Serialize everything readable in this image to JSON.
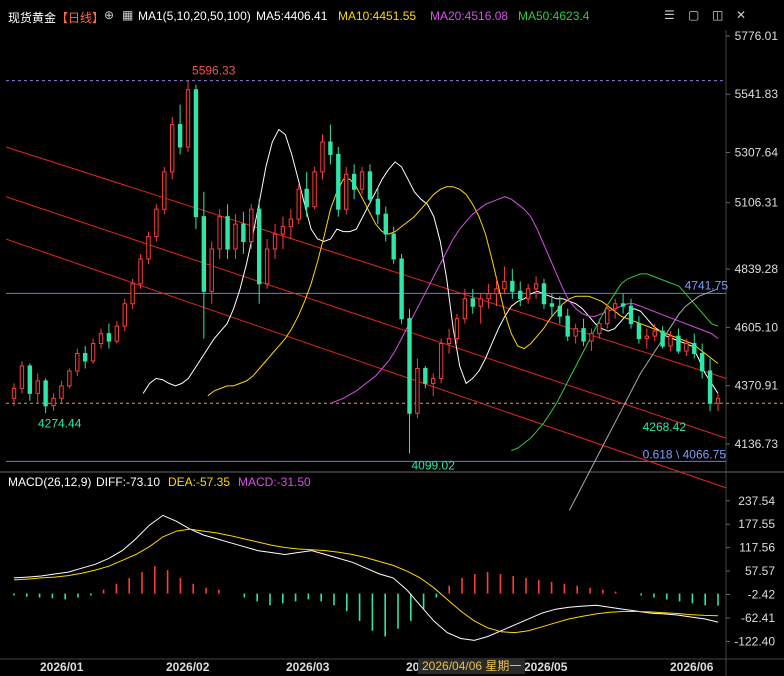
{
  "toolbar": {
    "symbol": "现货黄金",
    "period": "【日线】",
    "ma_label": "MA1(5,10,20,50,100)",
    "ma5": "MA5:4406.41",
    "ma10": "MA10:4451.55",
    "ma20": "MA20:4516.08",
    "ma50": "MA50:4623.4",
    "colors": {
      "ma5": "#ffffff",
      "ma10": "#ffd700",
      "ma20": "#d94fe6",
      "ma50": "#2ecc40",
      "symbol": "#ffffff",
      "period": "#ff6a3d"
    }
  },
  "macd": {
    "label": "MACD(26,12,9)",
    "diff": "DIFF:-73.10",
    "dea": "DEA:-57.35",
    "macd_val": "MACD:-31.50",
    "colors": {
      "diff": "#ffffff",
      "dea": "#ffd700",
      "macd": "#d94fe6"
    }
  },
  "price_axis": [
    "5776.01",
    "5541.83",
    "5307.64",
    "5106.31",
    "4839.28",
    "4605.10",
    "4370.91",
    "4136.73"
  ],
  "macd_axis": [
    "237.54",
    "177.55",
    "117.56",
    "57.57",
    "-2.42",
    "-62.41",
    "-122.40"
  ],
  "tags": {
    "current": "4741.75",
    "fib": "0.618 \\ 4066.75"
  },
  "annotations": {
    "high": "5596.33",
    "low": "4099.02",
    "left_low": "4274.44",
    "recent_low": "4268.42"
  },
  "x_labels": [
    "2026/01",
    "2026/02",
    "2026/03",
    "20",
    "2026/05",
    "2026/06"
  ],
  "crosshair_date": "2026/04/06 星期一",
  "chart_data": {
    "type": "line",
    "title": "现货黄金 日线",
    "xlabel": "",
    "ylabel": "",
    "ylim": [
      4040,
      5800
    ],
    "macd_ylim": [
      -165,
      260
    ],
    "n_candles": 110,
    "candles": [
      [
        4320,
        4380,
        4290,
        4360
      ],
      [
        4360,
        4470,
        4340,
        4450
      ],
      [
        4450,
        4460,
        4310,
        4340
      ],
      [
        4340,
        4420,
        4300,
        4390
      ],
      [
        4390,
        4400,
        4260,
        4290
      ],
      [
        4290,
        4340,
        4270,
        4320
      ],
      [
        4320,
        4390,
        4300,
        4370
      ],
      [
        4370,
        4440,
        4360,
        4430
      ],
      [
        4430,
        4520,
        4410,
        4500
      ],
      [
        4500,
        4530,
        4440,
        4470
      ],
      [
        4470,
        4560,
        4460,
        4540
      ],
      [
        4540,
        4600,
        4520,
        4580
      ],
      [
        4580,
        4620,
        4520,
        4550
      ],
      [
        4550,
        4630,
        4540,
        4610
      ],
      [
        4610,
        4720,
        4590,
        4700
      ],
      [
        4700,
        4800,
        4680,
        4780
      ],
      [
        4780,
        4900,
        4760,
        4880
      ],
      [
        4880,
        4990,
        4860,
        4970
      ],
      [
        4970,
        5100,
        4950,
        5080
      ],
      [
        5080,
        5250,
        5060,
        5230
      ],
      [
        5230,
        5450,
        5200,
        5420
      ],
      [
        5420,
        5500,
        5300,
        5330
      ],
      [
        5330,
        5596,
        5310,
        5560
      ],
      [
        5560,
        5580,
        5000,
        5050
      ],
      [
        5050,
        5150,
        4560,
        4750
      ],
      [
        4750,
        4950,
        4700,
        4920
      ],
      [
        4920,
        5080,
        4880,
        5050
      ],
      [
        5050,
        5100,
        4880,
        4920
      ],
      [
        4920,
        5060,
        4880,
        5020
      ],
      [
        5020,
        5070,
        4900,
        4950
      ],
      [
        4950,
        5100,
        4920,
        5080
      ],
      [
        5080,
        5120,
        4700,
        4780
      ],
      [
        4780,
        4960,
        4760,
        4920
      ],
      [
        4920,
        5020,
        4880,
        4980
      ],
      [
        4980,
        5050,
        4920,
        5010
      ],
      [
        5010,
        5080,
        4960,
        5040
      ],
      [
        5040,
        5180,
        5020,
        5160
      ],
      [
        5160,
        5230,
        5050,
        5090
      ],
      [
        5090,
        5250,
        5080,
        5230
      ],
      [
        5230,
        5380,
        5200,
        5350
      ],
      [
        5350,
        5420,
        5260,
        5300
      ],
      [
        5300,
        5330,
        5050,
        5080
      ],
      [
        5080,
        5250,
        5060,
        5220
      ],
      [
        5220,
        5260,
        5120,
        5160
      ],
      [
        5160,
        5250,
        5140,
        5230
      ],
      [
        5230,
        5260,
        5100,
        5120
      ],
      [
        5120,
        5170,
        5020,
        5060
      ],
      [
        5060,
        5090,
        4950,
        4980
      ],
      [
        4980,
        5010,
        4860,
        4880
      ],
      [
        4880,
        4900,
        4620,
        4640
      ],
      [
        4640,
        4680,
        4099,
        4260
      ],
      [
        4260,
        4480,
        4240,
        4440
      ],
      [
        4440,
        4450,
        4360,
        4380
      ],
      [
        4380,
        4420,
        4330,
        4400
      ],
      [
        4400,
        4560,
        4380,
        4540
      ],
      [
        4540,
        4600,
        4500,
        4560
      ],
      [
        4560,
        4660,
        4540,
        4640
      ],
      [
        4640,
        4760,
        4620,
        4720
      ],
      [
        4720,
        4760,
        4660,
        4690
      ],
      [
        4690,
        4740,
        4620,
        4720
      ],
      [
        4720,
        4780,
        4680,
        4740
      ],
      [
        4740,
        4800,
        4690,
        4760
      ],
      [
        4760,
        4850,
        4740,
        4790
      ],
      [
        4790,
        4840,
        4720,
        4750
      ],
      [
        4750,
        4790,
        4690,
        4720
      ],
      [
        4720,
        4780,
        4700,
        4760
      ],
      [
        4760,
        4810,
        4720,
        4780
      ],
      [
        4780,
        4800,
        4680,
        4700
      ],
      [
        4700,
        4740,
        4650,
        4690
      ],
      [
        4690,
        4730,
        4620,
        4650
      ],
      [
        4650,
        4680,
        4550,
        4570
      ],
      [
        4570,
        4620,
        4540,
        4600
      ],
      [
        4600,
        4640,
        4530,
        4550
      ],
      [
        4550,
        4600,
        4510,
        4580
      ],
      [
        4580,
        4640,
        4560,
        4620
      ],
      [
        4620,
        4700,
        4600,
        4680
      ],
      [
        4680,
        4720,
        4640,
        4700
      ],
      [
        4700,
        4740,
        4660,
        4690
      ],
      [
        4690,
        4720,
        4600,
        4620
      ],
      [
        4620,
        4650,
        4540,
        4560
      ],
      [
        4560,
        4600,
        4520,
        4570
      ],
      [
        4570,
        4620,
        4550,
        4590
      ],
      [
        4590,
        4610,
        4520,
        4530
      ],
      [
        4530,
        4590,
        4510,
        4570
      ],
      [
        4570,
        4600,
        4500,
        4510
      ],
      [
        4510,
        4560,
        4490,
        4540
      ],
      [
        4540,
        4580,
        4480,
        4500
      ],
      [
        4500,
        4540,
        4400,
        4430
      ],
      [
        4430,
        4480,
        4268,
        4300
      ],
      [
        4300,
        4340,
        4268,
        4320
      ]
    ],
    "ma": [
      {
        "name": "MA5",
        "color": "#ffffff",
        "values": [
          4340,
          4380,
          4400,
          4395,
          4380,
          4370,
          4380,
          4400,
          4440,
          4480,
          4520,
          4560,
          4590,
          4620,
          4680,
          4760,
          4860,
          4980,
          5110,
          5250,
          5350,
          5400,
          5380,
          5300,
          5200,
          5100,
          5000,
          4960,
          4950,
          4960,
          5000,
          4990,
          4990,
          5000,
          5050,
          5100,
          5150,
          5200,
          5240,
          5270,
          5250,
          5200,
          5150,
          5120,
          5100,
          5050,
          4950,
          4800,
          4600,
          4450,
          4380,
          4400,
          4430,
          4480,
          4540,
          4600,
          4650,
          4690,
          4710,
          4720,
          4740,
          4750,
          4740,
          4730,
          4720,
          4720,
          4710,
          4700,
          4680,
          4650,
          4620,
          4600,
          4590,
          4600,
          4630,
          4660,
          4680,
          4670,
          4640,
          4610,
          4590,
          4570,
          4560,
          4550,
          4540,
          4530,
          4480,
          4420,
          4380,
          4340
        ]
      },
      {
        "name": "MA10",
        "color": "#ffd700",
        "values": [
          4330,
          4350,
          4360,
          4370,
          4370,
          4380,
          4390,
          4410,
          4440,
          4470,
          4500,
          4530,
          4560,
          4600,
          4650,
          4710,
          4780,
          4870,
          4970,
          5080,
          5150,
          5200,
          5200,
          5170,
          5120,
          5070,
          5020,
          4990,
          4980,
          4990,
          5010,
          5030,
          5050,
          5080,
          5110,
          5140,
          5160,
          5170,
          5170,
          5160,
          5140,
          5100,
          5050,
          4980,
          4880,
          4770,
          4660,
          4580,
          4530,
          4520,
          4540,
          4570,
          4600,
          4640,
          4670,
          4700,
          4720,
          4730,
          4730,
          4730,
          4720,
          4710,
          4690,
          4670,
          4650,
          4640,
          4630,
          4620,
          4610,
          4600,
          4590,
          4580,
          4570,
          4560,
          4550,
          4540,
          4520,
          4500,
          4480,
          4460
        ]
      },
      {
        "name": "MA20",
        "color": "#d94fe6",
        "values": [
          4300,
          4310,
          4320,
          4335,
          4350,
          4370,
          4390,
          4410,
          4440,
          4470,
          4510,
          4560,
          4610,
          4660,
          4710,
          4760,
          4810,
          4860,
          4910,
          4960,
          5000,
          5030,
          5060,
          5080,
          5100,
          5110,
          5120,
          5130,
          5120,
          5100,
          5080,
          5050,
          5000,
          4940,
          4880,
          4820,
          4760,
          4710,
          4680,
          4660,
          4650,
          4650,
          4660,
          4670,
          4680,
          4690,
          4700,
          4700,
          4690,
          4680,
          4670,
          4660,
          4650,
          4640,
          4630,
          4620,
          4610,
          4600,
          4590,
          4580,
          4560
        ]
      },
      {
        "name": "MA50",
        "color": "#2ecc40",
        "values": [
          4110,
          4120,
          4140,
          4160,
          4190,
          4220,
          4260,
          4300,
          4350,
          4400,
          4450,
          4500,
          4550,
          4600,
          4650,
          4700,
          4740,
          4780,
          4800,
          4810,
          4820,
          4820,
          4810,
          4800,
          4790,
          4780,
          4770,
          4740,
          4710,
          4680,
          4650,
          4620,
          4610
        ]
      },
      {
        "name": "MA100",
        "color": "#aaaaaa",
        "values": [
          3870,
          3920,
          3970,
          4020,
          4070,
          4120,
          4170,
          4220,
          4270,
          4320,
          4370,
          4420,
          4460,
          4500,
          4540,
          4580,
          4620,
          4660,
          4690,
          4710,
          4730,
          4740,
          4750,
          4760
        ]
      }
    ],
    "macd_diff": [
      40,
      42,
      45,
      50,
      55,
      65,
      75,
      90,
      110,
      140,
      175,
      200,
      185,
      165,
      150,
      140,
      130,
      120,
      110,
      105,
      100,
      105,
      110,
      100,
      90,
      80,
      65,
      50,
      40,
      10,
      -30,
      -70,
      -100,
      -115,
      -120,
      -110,
      -95,
      -80,
      -65,
      -50,
      -40,
      -35,
      -32,
      -30,
      -35,
      -40,
      -45,
      -50,
      -52,
      -55,
      -60,
      -65,
      -73
    ],
    "macd_dea": [
      35,
      37,
      40,
      42,
      46,
      52,
      60,
      70,
      85,
      100,
      120,
      145,
      160,
      165,
      160,
      155,
      148,
      140,
      132,
      124,
      118,
      114,
      112,
      110,
      106,
      100,
      92,
      82,
      72,
      58,
      40,
      15,
      -15,
      -45,
      -70,
      -88,
      -98,
      -100,
      -95,
      -85,
      -75,
      -65,
      -58,
      -52,
      -48,
      -46,
      -46,
      -47,
      -49,
      -51,
      -54,
      -56,
      -57
    ],
    "macd_hist": [
      -5,
      -8,
      -10,
      -12,
      -15,
      -10,
      -5,
      10,
      25,
      40,
      55,
      70,
      60,
      40,
      25,
      15,
      10,
      0,
      -10,
      -20,
      -30,
      -25,
      -20,
      -15,
      -20,
      -30,
      -45,
      -70,
      -95,
      -110,
      -90,
      -70,
      -40,
      -10,
      20,
      40,
      50,
      55,
      50,
      45,
      40,
      35,
      30,
      25,
      20,
      15,
      10,
      5,
      0,
      -5,
      -10,
      -15,
      -20,
      -25,
      -30,
      -31
    ]
  }
}
